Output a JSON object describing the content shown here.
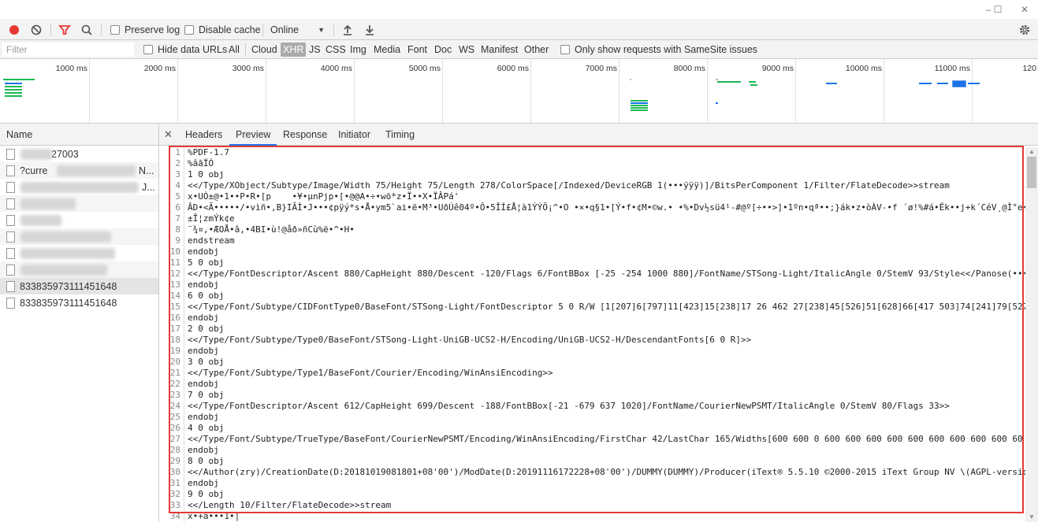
{
  "window": {
    "minimize": "–",
    "maximize": "☐",
    "close": "✕"
  },
  "toolbar": {
    "preserve_log": "Preserve log",
    "disable_cache": "Disable cache",
    "throttling": "Online"
  },
  "filter": {
    "placeholder": "Filter",
    "hide_data_urls": "Hide data URLs",
    "types": [
      "All",
      "Cloud",
      "XHR",
      "JS",
      "CSS",
      "Img",
      "Media",
      "Font",
      "Doc",
      "WS",
      "Manifest",
      "Other"
    ],
    "active_type": "XHR",
    "samesite": "Only show requests with SameSite issues"
  },
  "overview": {
    "ticks": [
      "1000 ms",
      "2000 ms",
      "3000 ms",
      "4000 ms",
      "5000 ms",
      "6000 ms",
      "7000 ms",
      "8000 ms",
      "9000 ms",
      "10000 ms",
      "11000 ms",
      "120"
    ]
  },
  "requests": {
    "header": "Name",
    "rows": [
      "27003",
      "?curre",
      "",
      "",
      "",
      "",
      "",
      "",
      "833835973111451648",
      "833835973111451648"
    ]
  },
  "details": {
    "tabs": [
      "Headers",
      "Preview",
      "Response",
      "Initiator",
      "Timing"
    ],
    "active_tab": "Preview",
    "lines": [
      "%PDF-1.7",
      "%âãÏÓ",
      "1 0 obj",
      "<</Type/XObject/Subtype/Image/Width 75/Height 75/Length 278/ColorSpace[/Indexed/DeviceRGB 1(•••ÿÿÿ)]/BitsPerComponent 1/Filter/FlateDecode>>stream",
      "x•UÒ±@•1••P•R•[p    •¥•µnPjp•[•@@A•÷•wö*z•Ï••X•ÏÂPá'",
      "ÂD•<Ã•••••/•vìñ•,B}IÃÌ•J•••¢pÿý*s•Å•ym5`ai•ë•M³•UðÚê04º•Ô•5ÎÍ£Å¦à1ÝÝÖ¡^•O •×•q§1•[Ý•f•¢M•©w.• •%•Dv½sü4¹-#@º[÷••>]•1ºn•qª••;}ák•z•òÀV-•f ´ø!%#á•Ëk••j+k´CéV¸@Ì°e•8",
      "±Î¦zmÝk¢e",
      "¨¾¤,•ÆOÅ•â,•4BI•ù!@åð»ñCù%ë•^•H•",
      "endstream",
      "endobj",
      "5 0 obj",
      "<</Type/FontDescriptor/Ascent 880/CapHeight 880/Descent -120/Flags 6/FontBBox [-25 -254 1000 880]/FontName/STSong-Light/ItalicAngle 0/StemV 93/Style<</Panose(•••",
      "endobj",
      "6 0 obj",
      "<</Type/Font/Subtype/CIDFontType0/BaseFont/STSong-Light/FontDescriptor 5 0 R/W [1[207]6[797]11[423]15[238]17 26 462 27[238]45[526]51[628]66[417 503]74[241]79[527",
      "endobj",
      "2 0 obj",
      "<</Type/Font/Subtype/Type0/BaseFont/STSong-Light-UniGB-UCS2-H/Encoding/UniGB-UCS2-H/DescendantFonts[6 0 R]>>",
      "endobj",
      "3 0 obj",
      "<</Type/Font/Subtype/Type1/BaseFont/Courier/Encoding/WinAnsiEncoding>>",
      "endobj",
      "7 0 obj",
      "<</Type/FontDescriptor/Ascent 612/CapHeight 699/Descent -188/FontBBox[-21 -679 637 1020]/FontName/CourierNewPSMT/ItalicAngle 0/StemV 80/Flags 33>>",
      "endobj",
      "4 0 obj",
      "<</Type/Font/Subtype/TrueType/BaseFont/CourierNewPSMT/Encoding/WinAnsiEncoding/FirstChar 42/LastChar 165/Widths[600 600 0 600 600 600 600 600 600 600 600 600 60",
      "endobj",
      "8 0 obj",
      "<</Author(zry)/CreationDate(D:20181019081801+08'00')/ModDate(D:20191116172228+08'00')/DUMMY(DUMMY)/Producer(iText® 5.5.10 ©2000-2015 iText Group NV \\(AGPL-versio",
      "endobj",
      "9 0 obj",
      "<</Length 10/Filter/FlateDecode>>stream",
      "x•+ä•••1•|"
    ]
  },
  "colors": {
    "record": "#e53935",
    "filter_icon": "#e53935",
    "highlight_box": "#e53935",
    "active_tab_underline": "#1a73e8",
    "timeline_green": "#1db954",
    "timeline_blue": "#1a73e8"
  }
}
